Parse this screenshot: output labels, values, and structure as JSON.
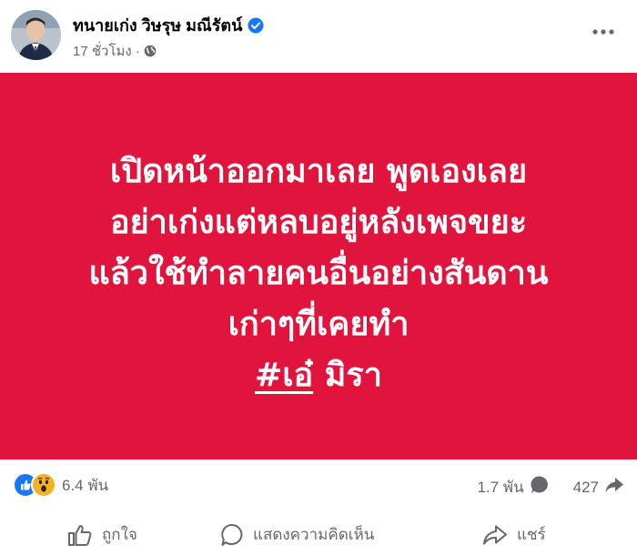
{
  "post": {
    "author": "ทนายเก่ง วิษรุษ มณีรัตน์",
    "time": "17 ชั่วโมง ·",
    "verified_icon": "verified-badge-icon",
    "privacy_icon": "globe-icon",
    "more_icon": "more-options-icon"
  },
  "image_text": {
    "line1": "เปิดหน้าออกมาเลย พูดเองเลย",
    "line2": "อย่าเก่งแต่หลบอยู่หลังเพจขยะ",
    "line3": "แล้วใช้ทำลายคนอื่นอย่างสันดาน",
    "line4": "เก่าๆที่เคยทำ",
    "hashtag": "#เอ๋",
    "tail": " มิรา",
    "background": "#e0143c"
  },
  "stats": {
    "reactions": "6.4 พัน",
    "comments": "1.7 พัน",
    "shares": "427"
  },
  "actions": {
    "like": "ถูกใจ",
    "comment": "แสดงความคิดเห็น",
    "share": "แชร์"
  },
  "colors": {
    "like_blue": "#1877f2",
    "wow_yellow": "#f7b125",
    "secondary_text": "#65676b"
  }
}
